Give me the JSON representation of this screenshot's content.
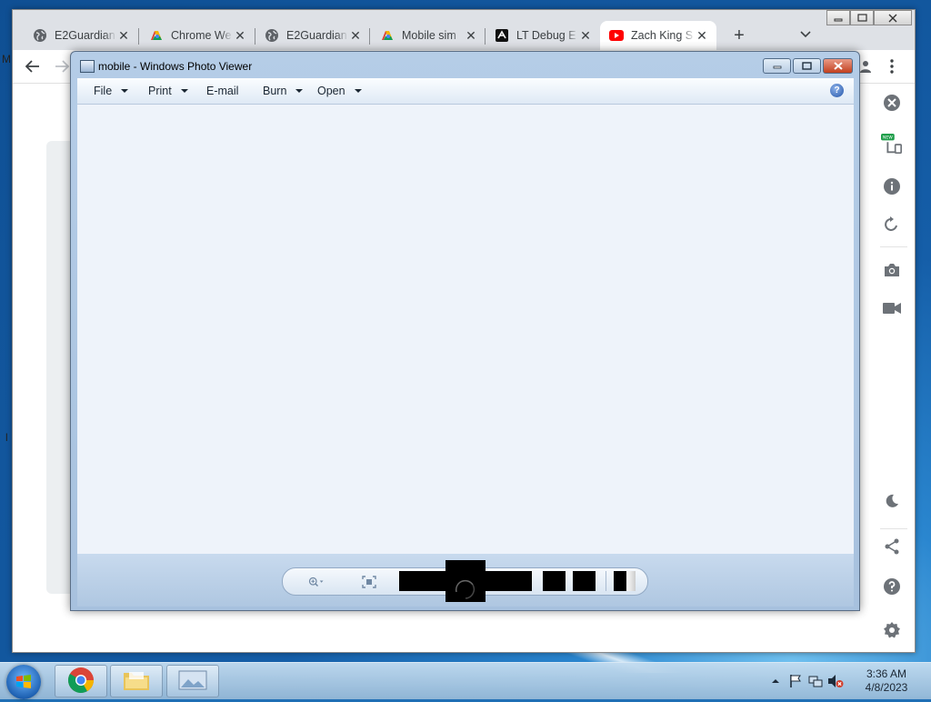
{
  "browser": {
    "tabs": [
      {
        "title": "E2Guardian",
        "icon": "globe-icon"
      },
      {
        "title": "Chrome We",
        "icon": "chrome-web-store-icon"
      },
      {
        "title": "E2Guardian",
        "icon": "globe-icon"
      },
      {
        "title": "Mobile sim",
        "icon": "mobile-sim-icon"
      },
      {
        "title": "LT Debug E",
        "icon": "lt-debug-icon"
      },
      {
        "title": "Zach King S",
        "icon": "youtube-icon"
      }
    ],
    "active_tab_index": 5,
    "new_tab_label": "+"
  },
  "photo_viewer": {
    "title": "mobile - Windows Photo Viewer",
    "menu": {
      "file": "File",
      "print": "Print",
      "email": "E-mail",
      "burn": "Burn",
      "open": "Open",
      "help": "?"
    }
  },
  "taskbar": {
    "time": "3:36 AM",
    "date": "4/8/2023"
  },
  "desktop_glyphs": {
    "m": "M",
    "l": "l"
  }
}
